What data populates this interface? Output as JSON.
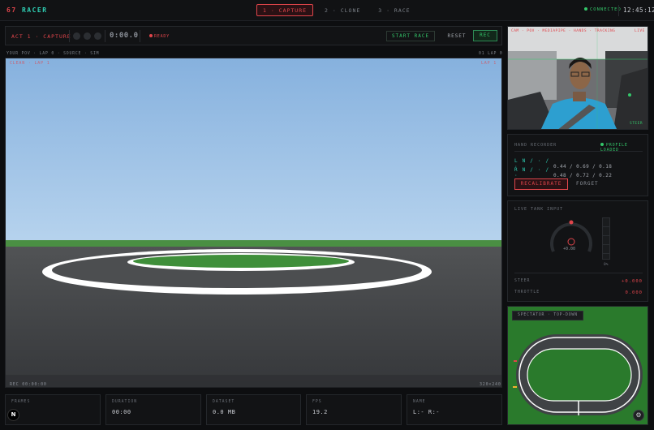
{
  "app": {
    "brand_num": "67",
    "brand_text": "RACER"
  },
  "steps": [
    {
      "label": "1 · CAPTURE",
      "active": true
    },
    {
      "label": "2 · CLONE",
      "active": false
    },
    {
      "label": "3 · RACE",
      "active": false
    }
  ],
  "status": {
    "connection": "CONNECTED",
    "clock": "12:45:12"
  },
  "controls": {
    "act": "ACT 1 · CAPTURE",
    "timer": "0:00.0",
    "ready": "READY",
    "start": "START RACE",
    "reset": "RESET",
    "rec": "REC"
  },
  "viewport": {
    "info_left": "YOUR POV · LAP 0 · SOURCE · SIM",
    "info_right": "01 LAP 0",
    "overlay_tl": "CLEAN · LAP 1",
    "overlay_tr": "LAP 1",
    "overlay_bl": "REC 00:00:00",
    "overlay_br": "320×240"
  },
  "stats": [
    {
      "label": "FRAMES",
      "value": ""
    },
    {
      "label": "DURATION",
      "value": "00:00"
    },
    {
      "label": "DATASET",
      "value": "0.0 MB"
    },
    {
      "label": "FPS",
      "value": "19.2"
    },
    {
      "label": "NAME",
      "value": "L:- R:-"
    }
  ],
  "camera": {
    "overlay_tl": "CAM · POV · MEDIAPIPE · HANDS · TRACKING",
    "overlay_tr": "LIVE",
    "overlay_br": "STEER"
  },
  "hand_recorder": {
    "title": "HAND RECORDER",
    "status": "PROFILE LOADED",
    "rows": [
      {
        "key": "L N / · / ·",
        "value": "0.44 / 0.69 / 0.18"
      },
      {
        "key": "R N / · / ·",
        "value": "0.48 / 0.72 / 0.22"
      }
    ],
    "recalibrate": "RECALIBRATE",
    "forget": "FORGET"
  },
  "tank": {
    "title": "LIVE TANK INPUT",
    "dial_value": "+0.00",
    "bar_label": "0%",
    "steer_label": "STEER",
    "steer_value": "+0.000",
    "throttle_label": "THROTTLE",
    "throttle_value": "0.000"
  },
  "spectator": {
    "tag": "SPECTATOR · TOP-DOWN"
  },
  "icons": {
    "logo": "N",
    "settings": "⚙"
  },
  "colors": {
    "accent_red": "#e0454b",
    "accent_teal": "#2fd0b5",
    "ok_green": "#34c76a",
    "sky": "#8fb8e2",
    "grass": "#2a7a2c"
  }
}
